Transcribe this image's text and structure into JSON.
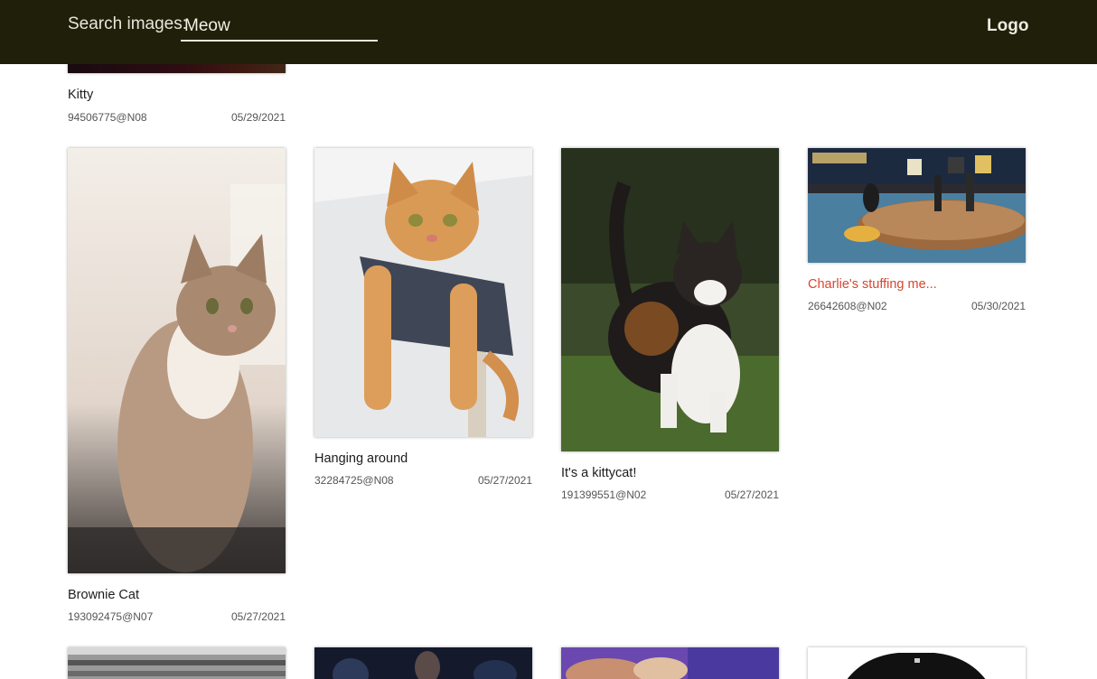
{
  "header": {
    "search_label": "Search images:",
    "search_value": "Meow",
    "logo": "Logo"
  },
  "cards": [
    {
      "title": "Kitty",
      "user": "94506775@N08",
      "date": "05/29/2021"
    },
    {
      "title": "Brownie Cat",
      "user": "193092475@N07",
      "date": "05/27/2021"
    },
    {
      "title": "Hanging around",
      "user": "32284725@N08",
      "date": "05/27/2021"
    },
    {
      "title": "It's a kittycat!",
      "user": "191399551@N02",
      "date": "05/27/2021"
    },
    {
      "title": "Charlie's stuffing me...",
      "user": "26642608@N02",
      "date": "05/30/2021"
    }
  ],
  "colors": {
    "header_bg": "#1f1f0a",
    "highlight_title": "#d8452e"
  }
}
